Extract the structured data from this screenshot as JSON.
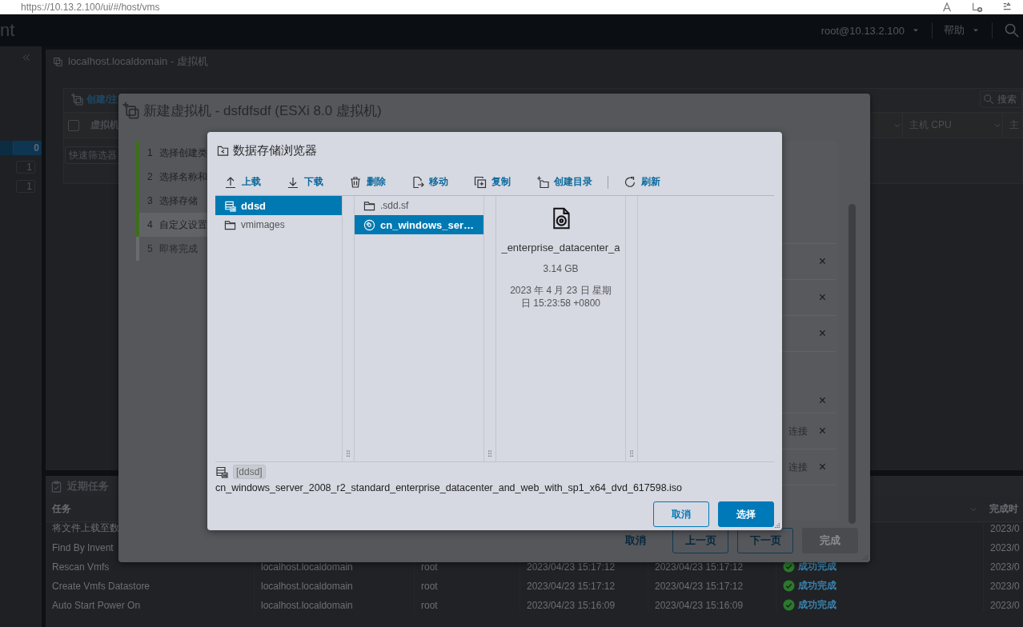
{
  "browser": {
    "url": "https://10.13.2.100/ui/#/host/vms"
  },
  "header": {
    "app_title": "nt",
    "user": "root@10.13.2.100",
    "help": "帮助"
  },
  "sidebar": {
    "counts": [
      {
        "value": "0",
        "selected": true
      },
      {
        "value": "1",
        "selected": false
      },
      {
        "value": "1",
        "selected": false
      }
    ]
  },
  "vm_panel": {
    "title": "localhost.localdomain - 虚拟机",
    "toolbar_action": "创建/注",
    "select_all": {
      "checked": false
    },
    "search": {
      "placeholder": "搜索"
    },
    "columns_left": [
      "虚拟机"
    ],
    "columns_right": [
      "主机 CPU",
      "主"
    ],
    "filter": {
      "placeholder": "快速筛选器"
    }
  },
  "tasks": {
    "title": "近期任务",
    "header": {
      "task": "任务",
      "completed": "完成时"
    },
    "rows": [
      {
        "task": "将文件上载至数",
        "completed": "2023/0"
      },
      {
        "task": "Find By Invent",
        "completed": "2023/0"
      },
      {
        "task": "Rescan Vmfs",
        "target": "localhost.localdomain",
        "initiator": "root",
        "queued": "2023/04/23 15:17:12",
        "started": "2023/04/23 15:17:12",
        "result": "成功完成",
        "completed": "2023/0"
      },
      {
        "task": "Create Vmfs Datastore",
        "target": "localhost.localdomain",
        "initiator": "root",
        "queued": "2023/04/23 15:17:12",
        "started": "2023/04/23 15:17:12",
        "result": "成功完成",
        "completed": "2023/0"
      },
      {
        "task": "Auto Start Power On",
        "target": "localhost.localdomain",
        "initiator": "root",
        "queued": "2023/04/23 15:16:09",
        "started": "2023/04/23 15:16:09",
        "result": "成功完成",
        "completed": "2023/0"
      }
    ]
  },
  "wizard": {
    "title": "新建虚拟机 - dsfdfsdf (ESXi 8.0 虚拟机)",
    "steps": [
      {
        "number": "1",
        "label": "选择创建类",
        "done": true,
        "current": false
      },
      {
        "number": "2",
        "label": "选择名称和",
        "done": true,
        "current": false
      },
      {
        "number": "3",
        "label": "选择存储",
        "done": true,
        "current": false
      },
      {
        "number": "4",
        "label": "自定义设置",
        "done": true,
        "current": true
      },
      {
        "number": "5",
        "label": "即将完成",
        "done": false,
        "current": false
      }
    ],
    "rows": [
      {
        "kind": "row",
        "remove": "×"
      },
      {
        "kind": "row",
        "remove": "×"
      },
      {
        "kind": "row",
        "remove": "×"
      },
      {
        "kind": "tall",
        "remove": "×"
      },
      {
        "kind": "row",
        "state": "连接",
        "remove": "×"
      },
      {
        "kind": "row",
        "state": "连接",
        "remove": "×"
      },
      {
        "kind": "blank"
      }
    ],
    "buttons": [
      {
        "label": "取消",
        "kind": "link",
        "disabled": false
      },
      {
        "label": "上一页",
        "kind": "outline",
        "disabled": false
      },
      {
        "label": "下一页",
        "kind": "outline",
        "disabled": false
      },
      {
        "label": "完成",
        "kind": "primary",
        "disabled": true
      }
    ]
  },
  "datastore_browser": {
    "title": "数据存储浏览器",
    "toolbar": [
      {
        "label": "上载",
        "kind": "upload",
        "separator_before": false
      },
      {
        "label": "下载",
        "kind": "download",
        "separator_before": false
      },
      {
        "label": "删除",
        "kind": "delete",
        "separator_before": false
      },
      {
        "label": "移动",
        "kind": "move",
        "separator_before": false
      },
      {
        "label": "复制",
        "kind": "copy",
        "separator_before": false
      },
      {
        "label": "创建目录",
        "kind": "new_folder",
        "separator_before": false
      },
      {
        "label": "刷新",
        "kind": "refresh",
        "separator_before": true
      }
    ],
    "columns": [
      [
        {
          "name": "ddsd",
          "kind": "datastore",
          "selected": true
        },
        {
          "name": "vmimages",
          "kind": "folder",
          "selected": false
        }
      ],
      [
        {
          "name": ".sdd.sf",
          "kind": "folder",
          "selected": false
        },
        {
          "name": "cn_windows_ser…",
          "kind": "disc",
          "selected": true
        }
      ]
    ],
    "preview": {
      "name": "_enterprise_datacenter_a",
      "size": "3.14 GB",
      "modified_lines": [
        "2023 年 4 月 23 日 星期",
        "日 15:23:58 +0800"
      ]
    },
    "path": {
      "datastore": "[ddsd]",
      "file": "cn_windows_server_2008_r2_standard_enterprise_datacenter_and_web_with_sp1_x64_dvd_617598.iso"
    },
    "buttons": [
      {
        "label": "取消",
        "kind": "outline"
      },
      {
        "label": "选择",
        "kind": "primary"
      }
    ]
  }
}
